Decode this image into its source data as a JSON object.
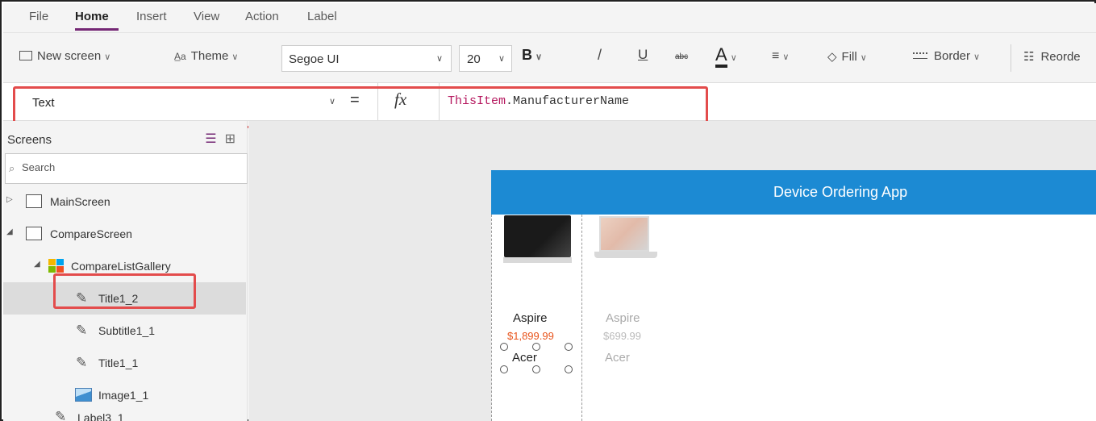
{
  "menu": {
    "items": [
      "File",
      "Home",
      "Insert",
      "View",
      "Action",
      "Label"
    ],
    "active": "Home"
  },
  "toolbar": {
    "new_screen": "New screen",
    "theme": "Theme",
    "font": "Segoe UI",
    "font_size": "20",
    "bold": "B",
    "italic": "/",
    "underline": "U",
    "strikethrough": "abc",
    "font_color": "A",
    "fill": "Fill",
    "border": "Border",
    "reorder": "Reorde"
  },
  "formula_bar": {
    "property": "Text",
    "equals": "=",
    "fx": "fx",
    "formula_keyword": "ThisItem",
    "formula_rest": ".ManufacturerName"
  },
  "tree_panel": {
    "title": "Screens",
    "search_placeholder": "Search",
    "items": [
      {
        "label": "MainScreen"
      },
      {
        "label": "CompareScreen"
      },
      {
        "label": "CompareListGallery"
      },
      {
        "label": "Title1_2",
        "selected": true
      },
      {
        "label": "Subtitle1_1"
      },
      {
        "label": "Title1_1"
      },
      {
        "label": "Image1_1"
      },
      {
        "label": "Label3_1"
      }
    ]
  },
  "app_preview": {
    "header_title": "Device Ordering App",
    "products": [
      {
        "title": "Aspire",
        "price": "$1,899.99",
        "manufacturer": "Acer",
        "icon": "monitor-image"
      },
      {
        "title": "Aspire",
        "price": "$699.99",
        "manufacturer": "Acer",
        "icon": "laptop-image"
      }
    ]
  },
  "colors": {
    "accent": "#742774",
    "highlight": "#e34c4c",
    "app_header": "#1c8ad3",
    "price_active": "#e8541c",
    "formula_keyword": "#b5175e"
  }
}
